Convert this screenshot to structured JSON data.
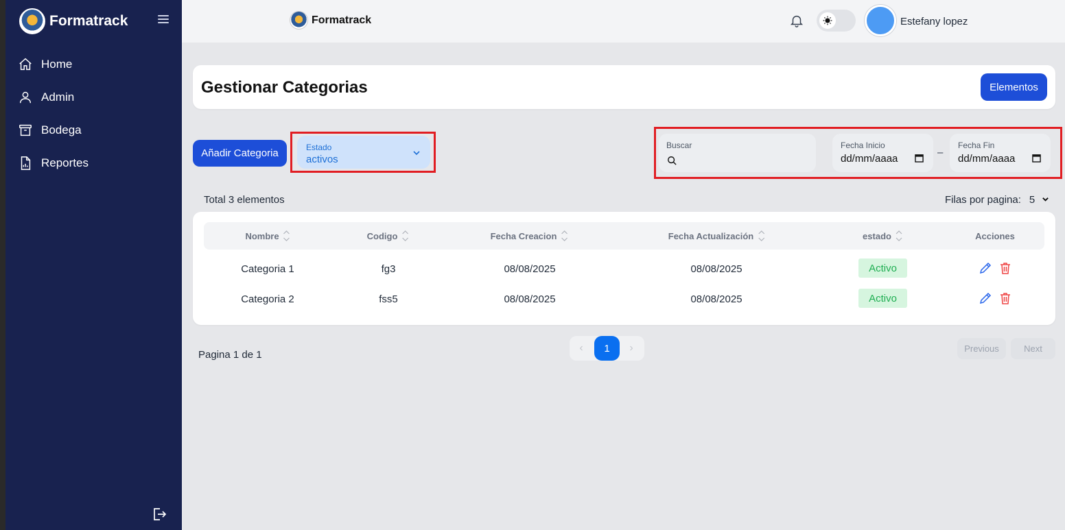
{
  "sidebar": {
    "brand": "Formatrack",
    "items": [
      {
        "label": "Home",
        "icon": "home-icon"
      },
      {
        "label": "Admin",
        "icon": "user-icon"
      },
      {
        "label": "Bodega",
        "icon": "archive-icon"
      },
      {
        "label": "Reportes",
        "icon": "report-icon"
      }
    ]
  },
  "topbar": {
    "brand": "Formatrack",
    "username": "Estefany lopez"
  },
  "header": {
    "title": "Gestionar Categorias",
    "elementos_label": "Elementos"
  },
  "controls": {
    "add_label": "Añadir Categoria",
    "estado_label": "Estado",
    "estado_value": "activos",
    "search_label": "Buscar",
    "fecha_inicio_label": "Fecha Inicio",
    "fecha_inicio_value": "dd/mm/aaaa",
    "fecha_fin_label": "Fecha Fin",
    "fecha_fin_value": "dd/mm/aaaa",
    "dash": "–"
  },
  "summary": {
    "total": "Total 3 elementos",
    "rows_label": "Filas por pagina:",
    "rows_value": "5"
  },
  "table": {
    "headers": [
      "Nombre",
      "Codigo",
      "Fecha Creacion",
      "Fecha Actualización",
      "estado",
      "Acciones"
    ],
    "rows": [
      {
        "nombre": "Categoria 1",
        "codigo": "fg3",
        "fecha_creacion": "08/08/2025",
        "fecha_actualizacion": "08/08/2025",
        "estado": "Activo"
      },
      {
        "nombre": "Categoria 2",
        "codigo": "fss5",
        "fecha_creacion": "08/08/2025",
        "fecha_actualizacion": "08/08/2025",
        "estado": "Activo"
      }
    ]
  },
  "footer": {
    "pagina": "Pagina 1 de 1",
    "current_page": "1",
    "prev_arrow": "‹",
    "next_arrow": "›",
    "previous_label": "Previous",
    "next_label": "Next"
  },
  "colors": {
    "sidebar_bg": "#18224f",
    "primary": "#1d4ed8",
    "badge_bg": "#d6f5df",
    "badge_text": "#1fae52",
    "highlight": "#e11d22"
  }
}
